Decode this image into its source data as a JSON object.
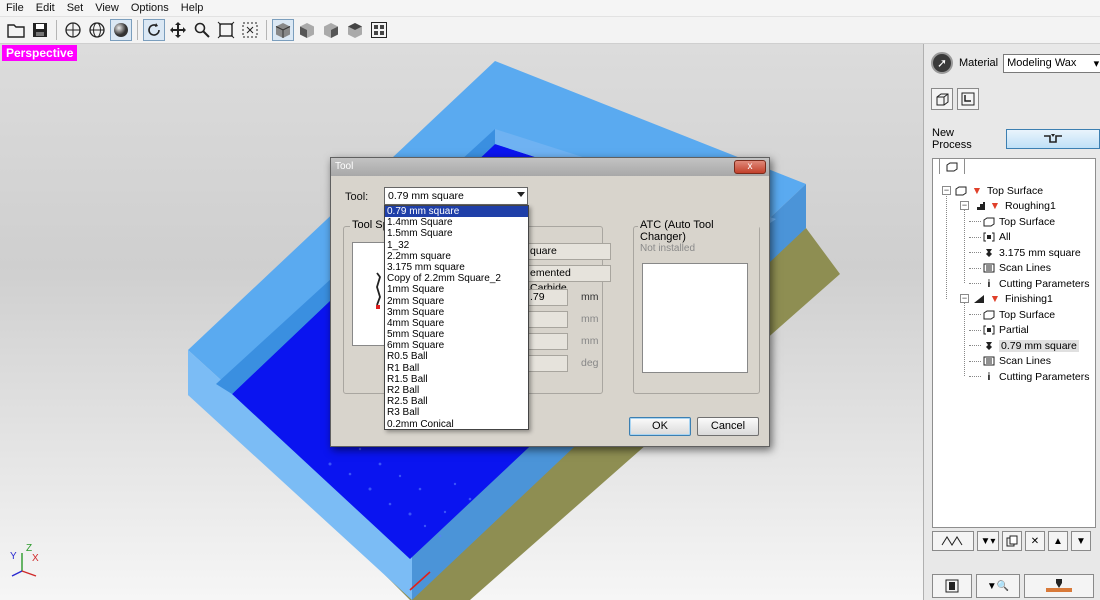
{
  "menu": [
    "File",
    "Edit",
    "Set",
    "View",
    "Options",
    "Help"
  ],
  "toolbar_icons": [
    "open-folder-icon",
    "save-icon",
    "globe-icon",
    "globe-grid-icon",
    "shaded-sphere-icon",
    "rotate-icon",
    "move-icon",
    "zoom-icon",
    "fit-view-icon",
    "zoom-window-icon",
    "view-iso-front-icon",
    "view-iso-left-icon",
    "view-iso-right-icon",
    "view-iso-back-icon",
    "view-fit-all-icon"
  ],
  "viewport": {
    "label": "Perspective",
    "axis": {
      "x": "X",
      "y": "Y",
      "z": "Z"
    }
  },
  "right_panel": {
    "material_label": "Material",
    "material_value": "Modeling Wax",
    "new_process_label": "New Process",
    "tree": [
      {
        "label": "Top Surface"
      },
      {
        "label": "Roughing1"
      },
      {
        "label": "Top Surface"
      },
      {
        "label": "All"
      },
      {
        "label": "3.175 mm square"
      },
      {
        "label": "Scan Lines"
      },
      {
        "label": "Cutting Parameters"
      },
      {
        "label": "Finishing1"
      },
      {
        "label": "Top Surface"
      },
      {
        "label": "Partial"
      },
      {
        "label": "0.79 mm square"
      },
      {
        "label": "Scan Lines"
      },
      {
        "label": "Cutting Parameters"
      }
    ]
  },
  "dialog": {
    "title": "Tool",
    "close": "x",
    "tool_label": "Tool:",
    "tool_value": "0.79 mm square",
    "spec_group": "Tool Sp",
    "field1": "quare",
    "field2": "emented Carbide",
    "field3": ".79",
    "unit_mm": "mm",
    "unit_deg": "deg",
    "atc_group": "ATC (Auto Tool Changer)",
    "atc_status": "Not installed",
    "ok": "OK",
    "cancel": "Cancel",
    "options": [
      "0.79 mm square",
      "1.4mm Square",
      "1.5mm Square",
      "1_32",
      "2.2mm square",
      "3.175 mm square",
      "Copy of 2.2mm Square_2",
      "1mm Square",
      "2mm Square",
      "3mm Square",
      "4mm Square",
      "5mm Square",
      "6mm Square",
      "R0.5 Ball",
      "R1 Ball",
      "R1.5 Ball",
      "R2 Ball",
      "R2.5 Ball",
      "R3 Ball",
      "0.2mm Conical"
    ],
    "selected_index": 0
  },
  "colors": {
    "model_light": "#55a8f0",
    "model_dark": "#0a14f0",
    "highlight": "#ff00ff",
    "selection": "#1f3fa8"
  }
}
